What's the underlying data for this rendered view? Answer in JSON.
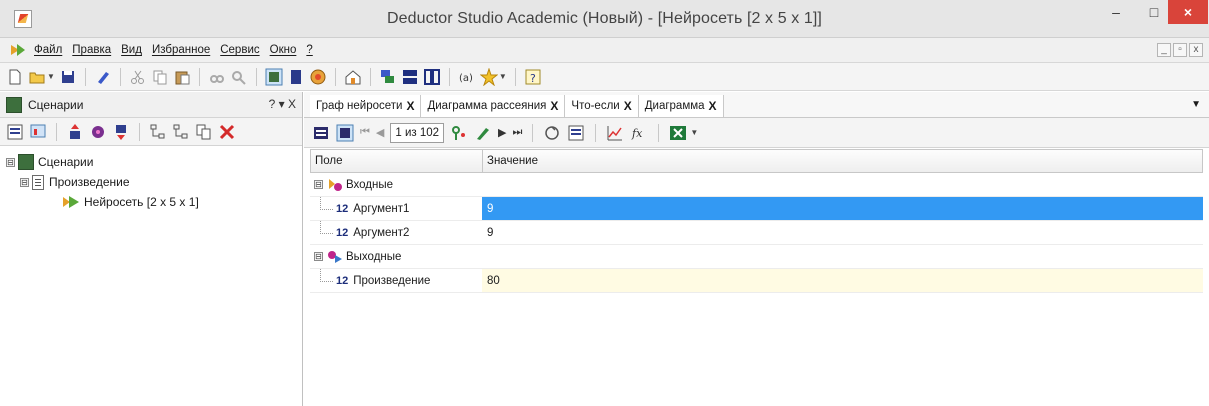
{
  "window": {
    "title": "Deductor Studio Academic (Новый) - [Нейросеть [2 x 5 x 1]]",
    "minimize": "–",
    "maximize": "□",
    "close": "×"
  },
  "menu": {
    "items": [
      "Файл",
      "Правка",
      "Вид",
      "Избранное",
      "Сервис",
      "Окно",
      "?"
    ],
    "mdi_min": "_",
    "mdi_restore": "▫",
    "mdi_close": "x"
  },
  "left_panel": {
    "title": "Сценарии",
    "controls": "? ▾ X",
    "tree": {
      "root": "Сценарии",
      "child": "Произведение",
      "leaf": "Нейросеть [2 x 5 x 1]",
      "expander": "⊟"
    }
  },
  "tabs": [
    {
      "label": "Граф нейросети",
      "close": "X"
    },
    {
      "label": "Диаграмма рассеяния",
      "close": "X"
    },
    {
      "label": "Что-если",
      "close": "X"
    },
    {
      "label": "Диаграмма",
      "close": "X"
    }
  ],
  "tabs_dropdown": "▼",
  "sub_toolbar": {
    "page_indicator": "1 из 102",
    "first": "⏮",
    "prev": "◀",
    "next": "▶",
    "last": "⏭"
  },
  "grid": {
    "columns": [
      "Поле",
      "Значение"
    ],
    "groups": [
      {
        "label": "Входные",
        "rows": [
          {
            "type": "12",
            "field": "Аргумент1",
            "value": "9"
          },
          {
            "type": "12",
            "field": "Аргумент2",
            "value": "9"
          }
        ]
      },
      {
        "label": "Выходные",
        "rows": [
          {
            "type": "12",
            "field": "Произведение",
            "value": "80"
          }
        ]
      }
    ]
  },
  "colors": {
    "selection": "#3399f3",
    "output_row": "#fffbe3",
    "close_button": "#d9443a"
  }
}
